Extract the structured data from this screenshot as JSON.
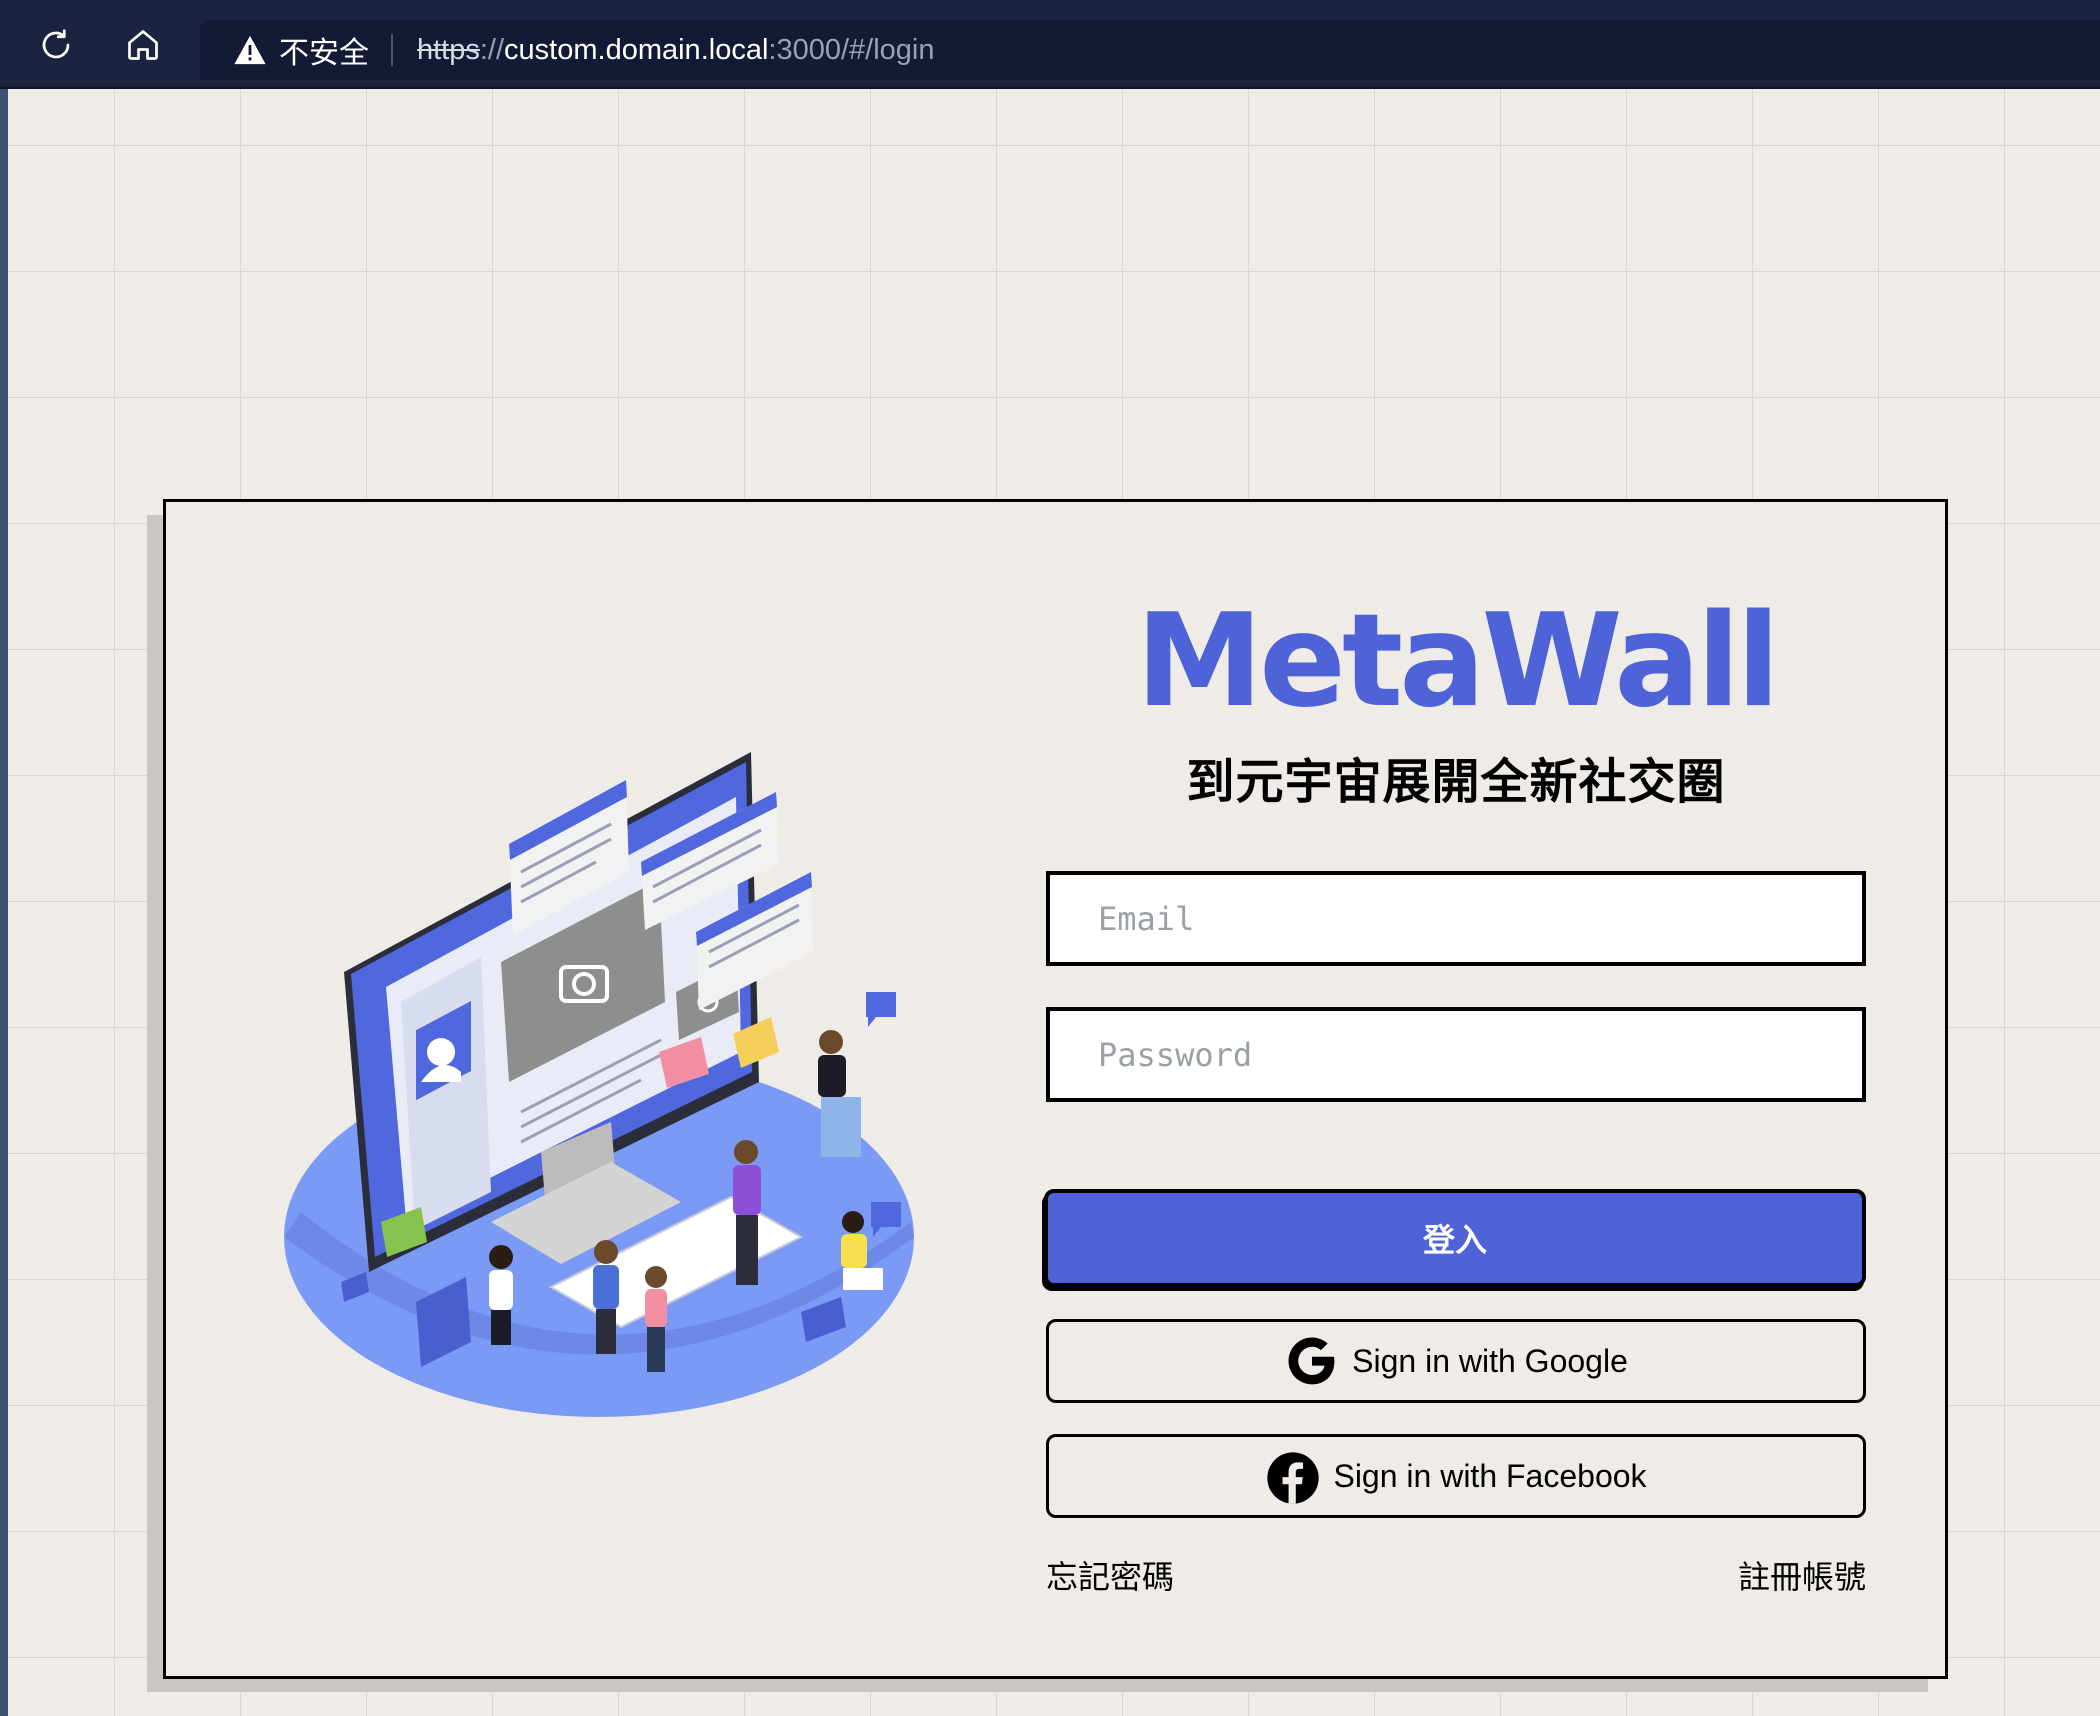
{
  "browser": {
    "reload_icon": "reload-icon",
    "home_icon": "home-icon",
    "security_warning": "不安全",
    "url": {
      "scheme": "https",
      "separator": "://",
      "host": "custom.domain.local",
      "rest": ":3000/#/login"
    }
  },
  "login": {
    "brand": "MetaWall",
    "tagline": "到元宇宙展開全新社交圈",
    "email_placeholder": "Email",
    "password_placeholder": "Password",
    "login_label": "登入",
    "google_label": "Sign in with Google",
    "facebook_label": "Sign in with Facebook",
    "forgot_password": "忘記密碼",
    "register": "註冊帳號"
  },
  "colors": {
    "accent": "#4f63d8",
    "background": "#efece7",
    "toolbar": "#1c2340"
  }
}
